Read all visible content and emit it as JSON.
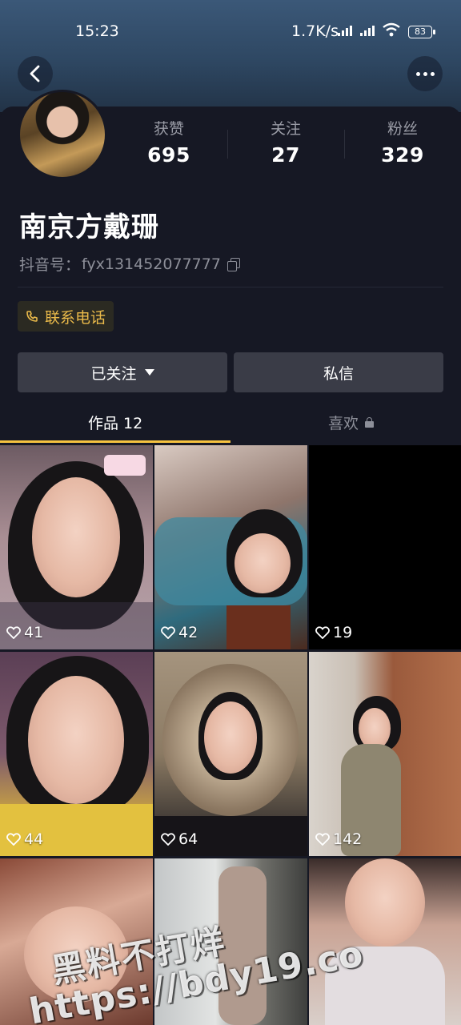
{
  "status_bar": {
    "time": "15:23",
    "network_speed": "1.7K/s",
    "battery": "83"
  },
  "header": {
    "back_icon": "chevron-left-icon",
    "more_icon": "more-horizontal-icon"
  },
  "profile": {
    "stats": [
      {
        "label": "获赞",
        "value": "695"
      },
      {
        "label": "关注",
        "value": "27"
      },
      {
        "label": "粉丝",
        "value": "329"
      }
    ],
    "name": "南京方戴珊",
    "douyin_id_label": "抖音号：",
    "douyin_id": "fyx131452077777",
    "contact_label": "联系电话",
    "follow_label": "已关注",
    "message_label": "私信"
  },
  "tabs": [
    {
      "label": "作品 12",
      "active": true
    },
    {
      "label": "喜欢",
      "active": false,
      "locked": true
    }
  ],
  "videos": [
    {
      "likes": "41"
    },
    {
      "likes": "42"
    },
    {
      "likes": "19"
    },
    {
      "likes": "44"
    },
    {
      "likes": "64"
    },
    {
      "likes": "142"
    },
    {
      "likes": ""
    },
    {
      "likes": ""
    },
    {
      "likes": ""
    }
  ],
  "watermark": {
    "line1": "黑料不打烊",
    "line2": "https://bdy19.co"
  },
  "colors": {
    "accent": "#f6c340",
    "background": "#161824",
    "button": "#3a3c47",
    "contact_text": "#e9b94a"
  }
}
